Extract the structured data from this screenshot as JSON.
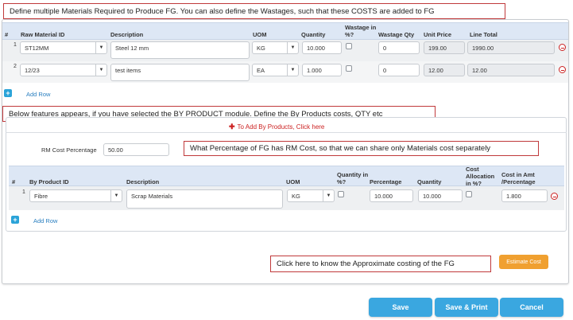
{
  "callouts": {
    "top": "Define multiple Materials Required to Produce FG. You can also define the Wastages, such that these COSTS are added to FG",
    "by_product": "Below features appears, if you have selected the BY PRODUCT module. Define the By Products costs, QTY etc",
    "percentage": "What Percentage of FG has RM Cost, so that we can share only Materials cost separately",
    "costing": "Click here to know the Approximate costing of the FG"
  },
  "materials_table": {
    "headers": {
      "num": "#",
      "raw_material_id": "Raw Material ID",
      "description": "Description",
      "uom": "UOM",
      "quantity": "Quantity",
      "wastage_pct": "Wastage in %?",
      "wastage_qty": "Wastage Qty",
      "unit_price": "Unit Price",
      "line_total": "Line Total"
    },
    "rows": [
      {
        "num": "1",
        "raw_material_id": "ST12MM",
        "description": "Steel 12 mm",
        "uom": "KG",
        "quantity": "10.000",
        "wastage_pct_checked": false,
        "wastage_qty": "0",
        "unit_price": "199.00",
        "line_total": "1990.00"
      },
      {
        "num": "2",
        "raw_material_id": "12/23",
        "description": "test items",
        "uom": "EA",
        "quantity": "1.000",
        "wastage_pct_checked": false,
        "wastage_qty": "0",
        "unit_price": "12.00",
        "line_total": "12.00"
      }
    ],
    "add_row": "Add Row"
  },
  "by_products": {
    "link": "To Add By Products, Click here",
    "rm_cost_label": "RM Cost Percentage",
    "rm_cost_value": "50.00",
    "headers": {
      "num": "#",
      "by_product_id": "By Product ID",
      "description": "Description",
      "uom": "UOM",
      "quantity_pct": "Quantity in %?",
      "percentage": "Percentage",
      "quantity": "Quantity",
      "cost_allocation": "Cost Allocation in %?",
      "cost_in_amt": "Cost in Amt /Percentage"
    },
    "rows": [
      {
        "num": "1",
        "by_product_id": "Fibre",
        "description": "Scrap Materials",
        "uom": "KG",
        "percentage": "10.000",
        "quantity": "10.000",
        "cost_in_amt": "1.800"
      }
    ],
    "add_row": "Add Row"
  },
  "buttons": {
    "estimate_cost": "Estimate Cost",
    "save": "Save",
    "save_print": "Save & Print",
    "cancel": "Cancel"
  },
  "colors": {
    "accent_blue": "#3aa7e0",
    "estimate_orange": "#f0a030",
    "callout_border": "#c0393b",
    "link_red": "#cc2222",
    "header_bg": "#dde7f5"
  }
}
